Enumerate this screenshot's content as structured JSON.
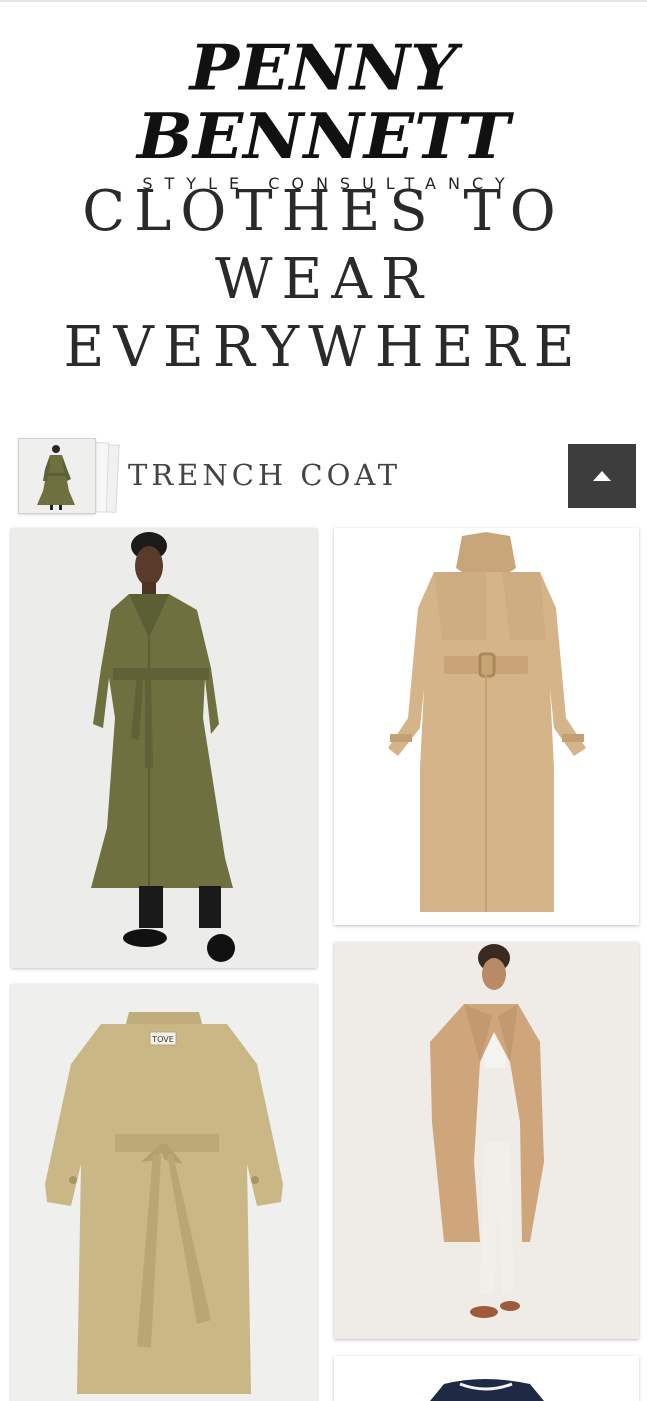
{
  "brand": {
    "name": "PENNY BENNETT",
    "tagline": "STYLE CONSULTANCY"
  },
  "headline": {
    "lines": [
      "CLOTHES TO",
      "WEAR",
      "EVERYWHERE"
    ]
  },
  "section": {
    "title": "TRENCH COAT",
    "scroll_top_icon": "caret-up-icon"
  },
  "products": [
    {
      "name": "olive-trench-on-model",
      "colors": {
        "coat": "#6e703f",
        "bg": "#ececea"
      }
    },
    {
      "name": "beige-trench-flatlay",
      "colors": {
        "coat": "#d5b48a",
        "bg": "#ffffff"
      }
    },
    {
      "name": "khaki-belted-trench",
      "label": "TOVE",
      "colors": {
        "coat": "#c9b786",
        "bg": "#efefed"
      }
    },
    {
      "name": "camel-trench-on-model",
      "colors": {
        "coat": "#cfa57c",
        "bg": "#efece8"
      }
    },
    {
      "name": "navy-knit-partial",
      "colors": {
        "coat": "#1e2a44",
        "bg": "#ffffff"
      }
    }
  ],
  "colors": {
    "button_bg": "#3d3d3d",
    "text": "#2a2a2a"
  }
}
